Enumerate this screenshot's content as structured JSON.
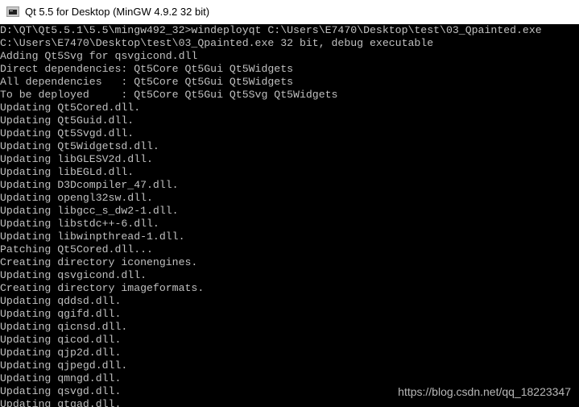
{
  "window": {
    "title": "Qt 5.5 for Desktop (MinGW 4.9.2 32 bit)",
    "icon": "console-icon"
  },
  "console": {
    "lines": [
      "D:\\QT\\Qt5.5.1\\5.5\\mingw492_32>windeployqt C:\\Users\\E7470\\Desktop\\test\\03_Qpainted.exe",
      "C:\\Users\\E7470\\Desktop\\test\\03_Qpainted.exe 32 bit, debug executable",
      "Adding Qt5Svg for qsvgicond.dll",
      "Direct dependencies: Qt5Core Qt5Gui Qt5Widgets",
      "All dependencies   : Qt5Core Qt5Gui Qt5Widgets",
      "To be deployed     : Qt5Core Qt5Gui Qt5Svg Qt5Widgets",
      "Updating Qt5Cored.dll.",
      "Updating Qt5Guid.dll.",
      "Updating Qt5Svgd.dll.",
      "Updating Qt5Widgetsd.dll.",
      "Updating libGLESV2d.dll.",
      "Updating libEGLd.dll.",
      "Updating D3Dcompiler_47.dll.",
      "Updating opengl32sw.dll.",
      "Updating libgcc_s_dw2-1.dll.",
      "Updating libstdc++-6.dll.",
      "Updating libwinpthread-1.dll.",
      "Patching Qt5Cored.dll...",
      "Creating directory iconengines.",
      "Updating qsvgicond.dll.",
      "Creating directory imageformats.",
      "Updating qddsd.dll.",
      "Updating qgifd.dll.",
      "Updating qicnsd.dll.",
      "Updating qicod.dll.",
      "Updating qjp2d.dll.",
      "Updating qjpegd.dll.",
      "Updating qmngd.dll.",
      "Updating qsvgd.dll.",
      "Updating qtgad.dll."
    ],
    "text_color": "#c0c0c0",
    "background_color": "#000000"
  },
  "watermark": {
    "text": "https://blog.csdn.net/qq_18223347"
  }
}
